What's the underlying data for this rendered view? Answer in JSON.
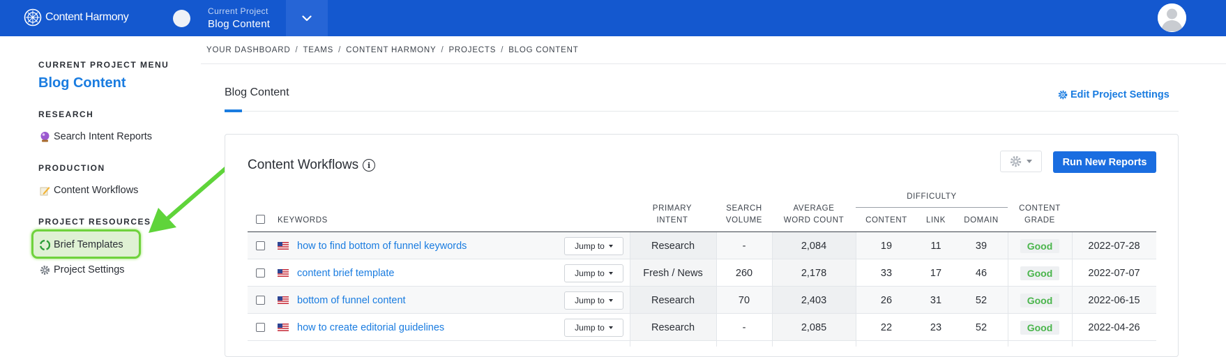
{
  "topbar": {
    "logo_text": "Content Harmony",
    "current_project_label": "Current Project",
    "current_project_value": "Blog Content"
  },
  "breadcrumb": [
    "YOUR DASHBOARD",
    "TEAMS",
    "CONTENT HARMONY",
    "PROJECTS",
    "BLOG CONTENT"
  ],
  "sidebar": {
    "menu_heading": "CURRENT PROJECT MENU",
    "project_name": "Blog Content",
    "research_heading": "RESEARCH",
    "search_intent": "Search Intent Reports",
    "production_heading": "PRODUCTION",
    "content_workflows": "Content Workflows",
    "resources_heading": "PROJECT RESOURCES",
    "brief_templates": "Brief Templates",
    "project_settings": "Project Settings"
  },
  "tab": {
    "title": "Blog Content",
    "edit_settings": "Edit Project Settings"
  },
  "card": {
    "title": "Content Workflows",
    "run_button": "Run New Reports"
  },
  "table": {
    "headers": {
      "keywords": "KEYWORDS",
      "primary_intent": [
        "PRIMARY",
        "INTENT"
      ],
      "search_volume": [
        "SEARCH",
        "VOLUME"
      ],
      "avg_word_count": [
        "AVERAGE",
        "WORD COUNT"
      ],
      "difficulty": "DIFFICULTY",
      "content": "CONTENT",
      "link": "LINK",
      "domain": "DOMAIN",
      "content_grade": [
        "CONTENT",
        "GRADE"
      ]
    },
    "jump_label": "Jump to",
    "rows": [
      {
        "keyword": "how to find bottom of funnel keywords",
        "intent": "Research",
        "volume": "-",
        "words": "2,084",
        "content": "19",
        "link": "11",
        "domain": "39",
        "grade": "Good",
        "date": "2022-07-28"
      },
      {
        "keyword": "content brief template",
        "intent": "Fresh / News",
        "volume": "260",
        "words": "2,178",
        "content": "33",
        "link": "17",
        "domain": "46",
        "grade": "Good",
        "date": "2022-07-07"
      },
      {
        "keyword": "bottom of funnel content",
        "intent": "Research",
        "volume": "70",
        "words": "2,403",
        "content": "26",
        "link": "31",
        "domain": "52",
        "grade": "Good",
        "date": "2022-06-15"
      },
      {
        "keyword": "how to create editorial guidelines",
        "intent": "Research",
        "volume": "-",
        "words": "2,085",
        "content": "22",
        "link": "23",
        "domain": "52",
        "grade": "Good",
        "date": "2022-04-26"
      }
    ]
  },
  "colors": {
    "topbar": "#1458cf",
    "accent": "#1a7ce0",
    "highlight_green": "#6fd23d",
    "grade_good": "#4ab54c"
  }
}
